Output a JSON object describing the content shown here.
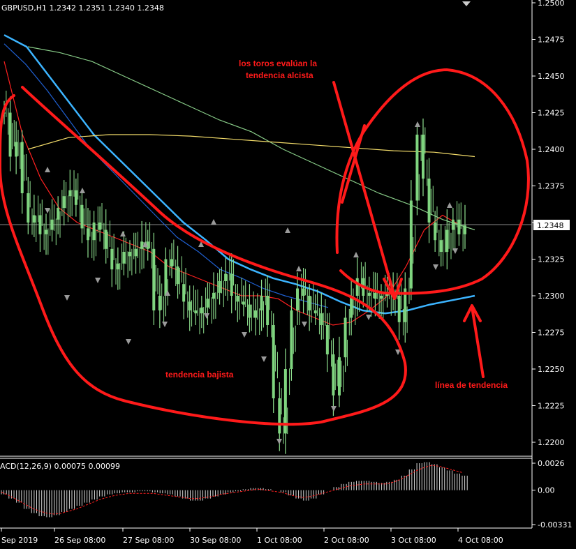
{
  "chart_data": [
    {
      "type": "candlestick",
      "symbol_header": "GBPUSD,H1  1.2342 1.2351 1.2340 1.2348",
      "last_price_label": "1.2348",
      "last_price": 1.2348,
      "ylim": [
        1.2185,
        1.25
      ],
      "y_ticks": [
        "1.2500",
        "1.2475",
        "1.2450",
        "1.2425",
        "1.2400",
        "1.2375",
        "1.2350",
        "1.2325",
        "1.2300",
        "1.2275",
        "1.2250",
        "1.2225",
        "1.2200"
      ],
      "x_ticks": [
        "Sep 2019",
        "26 Sep 08:00",
        "27 Sep 08:00",
        "30 Sep 08:00",
        "1 Oct 08:00",
        "2 Oct 08:00",
        "3 Oct 08:00",
        "4 Oct 08:00"
      ],
      "close_path": [
        1.2425,
        1.2395,
        1.2405,
        1.237,
        1.235,
        1.2355,
        1.2342,
        1.2345,
        1.2352,
        1.236,
        1.2368,
        1.2372,
        1.2362,
        1.2346,
        1.2338,
        1.235,
        1.2345,
        1.2332,
        1.2318,
        1.2322,
        1.233,
        1.2327,
        1.2332,
        1.2337,
        1.2332,
        1.229,
        1.23,
        1.2325,
        1.232,
        1.2308,
        1.2296,
        1.229,
        1.2288,
        1.2292,
        1.2298,
        1.2302,
        1.231,
        1.2315,
        1.23,
        1.2296,
        1.2294,
        1.2285,
        1.229,
        1.23,
        1.228,
        1.223,
        1.2206,
        1.225,
        1.229,
        1.2305,
        1.23,
        1.229,
        1.2288,
        1.228,
        1.226,
        1.2232,
        1.2258,
        1.2285,
        1.23,
        1.2312,
        1.23,
        1.2302,
        1.2298,
        1.23,
        1.2302,
        1.23,
        1.2282,
        1.2305,
        1.2365,
        1.241,
        1.238,
        1.235,
        1.2338,
        1.233,
        1.2345,
        1.2352,
        1.2342,
        1.2348
      ],
      "series": [
        {
          "name": "",
          "color": "#ff2020",
          "values": [
            1.246,
            1.241,
            1.238,
            1.236,
            1.235,
            1.2345,
            1.234,
            1.2335,
            1.233,
            1.232,
            1.2315,
            1.231,
            1.2305,
            1.23,
            1.23,
            1.2298,
            1.229,
            1.2285,
            1.228,
            1.2282,
            1.229,
            1.23,
            1.232,
            1.2345,
            1.2355,
            1.2348
          ]
        },
        {
          "name": "",
          "color": "#3cb4ff",
          "values": [
            1.2478,
            1.247,
            1.245,
            1.243,
            1.241,
            1.2395,
            1.238,
            1.2365,
            1.235,
            1.2338,
            1.2325,
            1.2318,
            1.2312,
            1.2308,
            1.2303,
            1.2296,
            1.229,
            1.2288,
            1.229,
            1.2294,
            1.2297,
            1.23
          ]
        },
        {
          "name": "",
          "color": "#1f5fd0",
          "values": [
            1.2472,
            1.2458,
            1.244,
            1.242,
            1.24,
            1.2385,
            1.237,
            1.2355,
            1.234,
            1.233,
            1.2318,
            1.2312,
            1.2305,
            1.23,
            1.2296,
            1.2292
          ]
        },
        {
          "name": "",
          "color": "#88cc88",
          "values": [
            1.247,
            1.2466,
            1.246,
            1.245,
            1.244,
            1.243,
            1.242,
            1.2412,
            1.24,
            1.239,
            1.238,
            1.237,
            1.2362,
            1.2352,
            1.2345
          ]
        },
        {
          "name": "",
          "color": "#f3dc6a",
          "values": [
            1.24,
            1.2408,
            1.241,
            1.241,
            1.2409,
            1.2407,
            1.2405,
            1.2403,
            1.2401,
            1.2399,
            1.2398,
            1.2395
          ]
        }
      ],
      "annotations": [
        {
          "text_lines": [
            "los toros evalúan la",
            "tendencia alcista"
          ],
          "color": "#ff1a1a"
        },
        {
          "text_lines": [
            "tendencia bajista"
          ],
          "color": "#ff1a1a"
        },
        {
          "text_lines": [
            "línea de tendencia"
          ],
          "color": "#ff1a1a"
        }
      ]
    },
    {
      "type": "bar",
      "indicator_header": "ACD(12,26,9) 0.00075 0.00099",
      "y_ticks": [
        "0.0026",
        "0.00",
        "-0.00331"
      ],
      "ylim": [
        -0.0036,
        0.003
      ],
      "histogram": [
        -0.0004,
        -0.0008,
        -0.0012,
        -0.0018,
        -0.0022,
        -0.0025,
        -0.0026,
        -0.0024,
        -0.0021,
        -0.0018,
        -0.0015,
        -0.0012,
        -0.0009,
        -0.0006,
        -0.0004,
        -0.0003,
        -0.0002,
        -0.0002,
        -0.0001,
        -0.0001,
        -0.0002,
        -0.0003,
        -0.0004,
        -0.0006,
        -0.0008,
        -0.001,
        -0.001,
        -0.0008,
        -0.0006,
        -0.0004,
        -0.0002,
        -0.0001,
        0.0001,
        0.0002,
        0.0002,
        0.0001,
        0.0,
        -0.0002,
        -0.0005,
        -0.0008,
        -0.001,
        -0.0008,
        -0.0004,
        0.0,
        0.0003,
        0.0006,
        0.0008,
        0.0009,
        0.0009,
        0.0008,
        0.0007,
        0.0008,
        0.001,
        0.0014,
        0.002,
        0.0026,
        0.0027,
        0.0025,
        0.0022,
        0.0019,
        0.0016,
        0.0014
      ],
      "signal": [
        -0.0002,
        -0.0005,
        -0.0009,
        -0.0013,
        -0.0017,
        -0.002,
        -0.0022,
        -0.0023,
        -0.0022,
        -0.002,
        -0.0018,
        -0.0015,
        -0.0012,
        -0.0009,
        -0.0007,
        -0.0005,
        -0.0004,
        -0.0003,
        -0.0003,
        -0.0003,
        -0.0003,
        -0.0004,
        -0.0005,
        -0.0006,
        -0.0007,
        -0.0008,
        -0.0008,
        -0.0007,
        -0.0006,
        -0.0004,
        -0.0003,
        -0.0002,
        -0.0001,
        0.0,
        0.0001,
        0.0,
        -0.0001,
        -0.0002,
        -0.0004,
        -0.0006,
        -0.0007,
        -0.0006,
        -0.0004,
        -0.0002,
        0.0,
        0.0002,
        0.0004,
        0.0005,
        0.0006,
        0.0006,
        0.0006,
        0.0006,
        0.0008,
        0.0011,
        0.0015,
        0.0019,
        0.0022,
        0.0024,
        0.0023,
        0.0021,
        0.0019,
        0.0017
      ]
    }
  ]
}
